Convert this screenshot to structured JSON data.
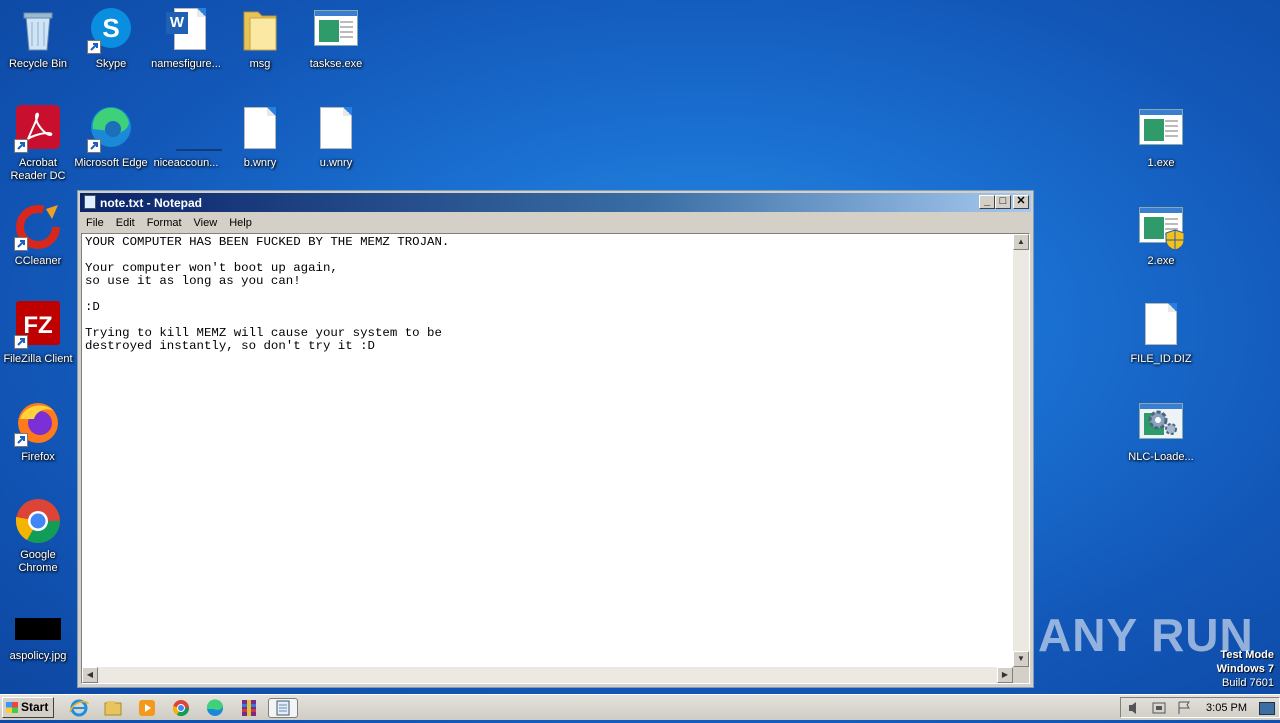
{
  "desktop": {
    "left_icons": [
      {
        "label": "Recycle Bin",
        "icon": "recycle-bin-icon"
      },
      {
        "label": "Skype",
        "icon": "skype-icon"
      },
      {
        "label": "namesfigure...",
        "icon": "word-document-icon"
      },
      {
        "label": "msg",
        "icon": "folder-icon"
      },
      {
        "label": "taskse.exe",
        "icon": "exe-icon"
      },
      {
        "label": "Acrobat Reader DC",
        "icon": "acrobat-icon"
      },
      {
        "label": "Microsoft Edge",
        "icon": "edge-icon"
      },
      {
        "label": "niceaccoun...",
        "icon": "blank-icon"
      },
      {
        "label": "b.wnry",
        "icon": "file-icon"
      },
      {
        "label": "u.wnry",
        "icon": "file-icon"
      },
      {
        "label": "CCleaner",
        "icon": "ccleaner-icon"
      },
      {
        "label": "FileZilla Client",
        "icon": "filezilla-icon"
      },
      {
        "label": "Firefox",
        "icon": "firefox-icon"
      },
      {
        "label": "Google Chrome",
        "icon": "chrome-icon"
      },
      {
        "label": "aspolicy.jpg",
        "icon": "image-file-icon"
      }
    ],
    "right_icons": [
      {
        "label": "1.exe",
        "icon": "exe-icon"
      },
      {
        "label": "2.exe",
        "icon": "exe-shield-icon"
      },
      {
        "label": "FILE_ID.DIZ",
        "icon": "file-icon"
      },
      {
        "label": "NLC-Loade...",
        "icon": "gear-exe-icon"
      }
    ]
  },
  "notepad": {
    "title": "note.txt - Notepad",
    "menu": [
      "File",
      "Edit",
      "Format",
      "View",
      "Help"
    ],
    "content": "YOUR COMPUTER HAS BEEN FUCKED BY THE MEMZ TROJAN.\n\nYour computer won't boot up again,\nso use it as long as you can!\n\n:D\n\nTrying to kill MEMZ will cause your system to be\ndestroyed instantly, so don't try it :D",
    "minimize_glyph": "_",
    "maximize_glyph": "□",
    "close_glyph": "✕"
  },
  "watermark": {
    "brand": "ANY RUN",
    "mode_line1": "Test Mode",
    "mode_line2": "Windows 7",
    "mode_line3": "Build 7601"
  },
  "taskbar": {
    "start_label": "Start",
    "clock": "3:05 PM",
    "pinned": [
      "ie-icon",
      "explorer-icon",
      "media-player-icon",
      "chrome-icon",
      "edge-icon",
      "winrar-icon",
      "notepad-icon"
    ]
  }
}
